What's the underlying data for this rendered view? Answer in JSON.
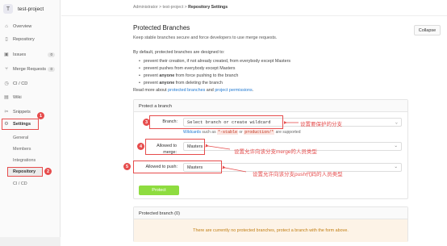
{
  "sidebar": {
    "avatar_letter": "T",
    "project_name": "test-project",
    "items": [
      {
        "label": "Overview",
        "icon": "home-icon"
      },
      {
        "label": "Repository",
        "icon": "book-icon"
      },
      {
        "label": "Issues",
        "icon": "issues-icon",
        "count": "0"
      },
      {
        "label": "Merge Requests",
        "icon": "merge-icon",
        "count": "0"
      },
      {
        "label": "CI / CD",
        "icon": "rocket-icon"
      },
      {
        "label": "Wiki",
        "icon": "book-open-icon"
      },
      {
        "label": "Snippets",
        "icon": "scissors-icon"
      },
      {
        "label": "Settings",
        "icon": "gear-icon"
      }
    ],
    "sub_items": [
      "General",
      "Members",
      "Integrations",
      "Repository",
      "CI / CD"
    ]
  },
  "breadcrumb": {
    "part1": "Administrator",
    "sep": ">",
    "part2": "test-project",
    "part3": "Repository Settings"
  },
  "section": {
    "title": "Protected Branches",
    "subtitle": "Keep stable branches secure and force developers to use merge requests.",
    "collapse_label": "Collapse",
    "intro": "By default, protected branches are designed to:",
    "bullets": [
      {
        "pre": "prevent their creation, if not already created, from everybody except Masters",
        "bold": "",
        "post": ""
      },
      {
        "pre": "prevent pushes from everybody except Masters",
        "bold": "",
        "post": ""
      },
      {
        "pre": "prevent ",
        "bold": "anyone",
        "post": " from force pushing to the branch"
      },
      {
        "pre": "prevent ",
        "bold": "anyone",
        "post": " from deleting the branch"
      }
    ],
    "read_more_pre": "Read more about ",
    "read_more_link1": "protected branches",
    "read_more_mid": " and ",
    "read_more_link2": "project permissions",
    "read_more_post": "."
  },
  "form": {
    "header": "Protect a branch",
    "branch_label": "Branch:",
    "branch_placeholder": "Select branch or create wildcard",
    "help_link": "Wildcards",
    "help_mid": " such as ",
    "help_code1": "*-stable",
    "help_or": " or ",
    "help_code2": "production/*",
    "help_post": " are supported",
    "merge_label": "Allowed to merge:",
    "merge_value": "Masters",
    "push_label": "Allowed to push:",
    "push_value": "Masters",
    "protect_button": "Protect"
  },
  "protected_list": {
    "header": "Protected branch (0)",
    "empty_text": "There are currently no protected branches, protect a branch with the form above."
  },
  "annotations": {
    "n1": "1",
    "n2": "2",
    "n3": "3",
    "n4": "4",
    "n5": "5",
    "note3": "设置要保护的分支",
    "note4": "设置允许向该分支merge的人员类型",
    "note5": "设置允许向该分支push代码的人员类型",
    "color": "#e64c4c"
  }
}
